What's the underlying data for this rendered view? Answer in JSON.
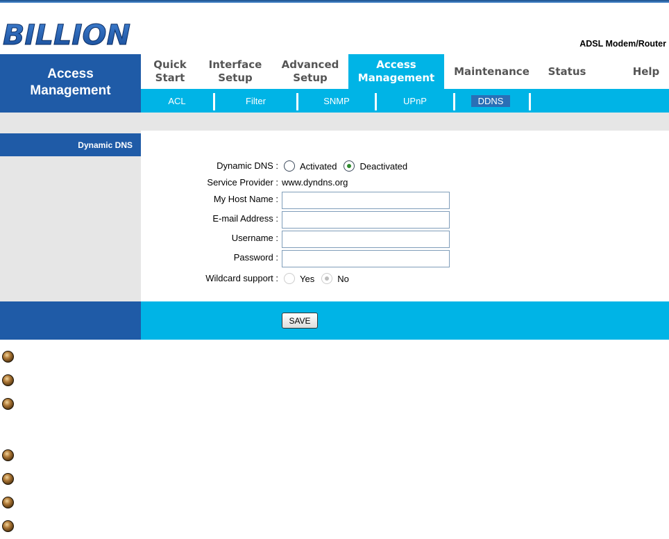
{
  "header": {
    "logo_text": "BILLION",
    "product": "ADSL Modem/Router"
  },
  "left_title": {
    "line1": "Access",
    "line2": "Management"
  },
  "menu": [
    {
      "label": "Quick\nStart"
    },
    {
      "label": "Interface\nSetup"
    },
    {
      "label": "Advanced\nSetup"
    },
    {
      "label": "Access\nManagement",
      "active": true
    },
    {
      "label": "Maintenance"
    },
    {
      "label": "Status"
    },
    {
      "label": "Help"
    }
  ],
  "submenu": [
    {
      "label": "ACL"
    },
    {
      "label": "Filter"
    },
    {
      "label": "SNMP"
    },
    {
      "label": "UPnP"
    },
    {
      "label": "DDNS",
      "active": true
    }
  ],
  "section": {
    "title": "Dynamic DNS"
  },
  "form": {
    "dynamic_dns_label": "Dynamic DNS :",
    "activated_label": "Activated",
    "deactivated_label": "Deactivated",
    "dynamic_dns_value": "Deactivated",
    "service_provider_label": "Service Provider :",
    "service_provider_value": "www.dyndns.org",
    "host_name_label": "My Host Name :",
    "host_name_value": "",
    "email_label": "E-mail Address :",
    "email_value": "",
    "username_label": "Username :",
    "username_value": "",
    "password_label": "Password :",
    "password_value": "",
    "wildcard_label": "Wildcard support :",
    "yes_label": "Yes",
    "no_label": "No",
    "wildcard_value": "No"
  },
  "save_label": "SAVE",
  "colors": {
    "dark_blue": "#1f5ba7",
    "light_blue": "#00b4e6",
    "grey": "#e6e6e6"
  }
}
